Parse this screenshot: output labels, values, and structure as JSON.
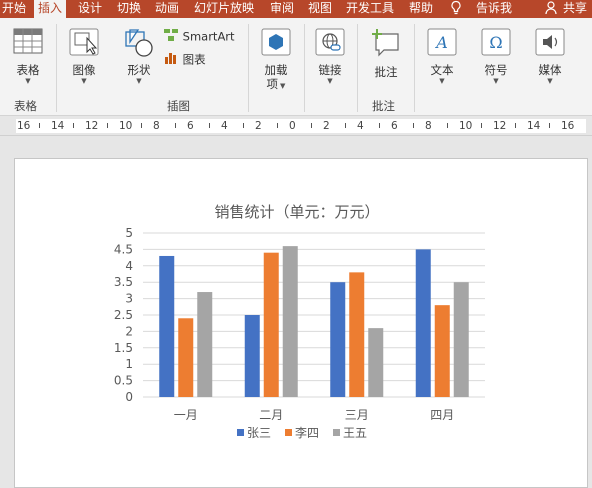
{
  "tabs": [
    {
      "label": "开始",
      "active": false
    },
    {
      "label": "插入",
      "active": true
    },
    {
      "label": "设计",
      "active": false
    },
    {
      "label": "切换",
      "active": false
    },
    {
      "label": "动画",
      "active": false
    },
    {
      "label": "幻灯片放映",
      "active": false
    },
    {
      "label": "审阅",
      "active": false
    },
    {
      "label": "视图",
      "active": false
    },
    {
      "label": "开发工具",
      "active": false
    },
    {
      "label": "帮助",
      "active": false
    }
  ],
  "tellme": {
    "label": "告诉我",
    "icon": "lightbulb-icon"
  },
  "share": {
    "label": "共享",
    "icon": "person-icon"
  },
  "ribbon": {
    "table": {
      "label": "表格",
      "group": "表格"
    },
    "image": {
      "label": "图像"
    },
    "shapes": {
      "label": "形状"
    },
    "smartart": {
      "label": "SmartArt"
    },
    "chart": {
      "label": "图表"
    },
    "illustrations_group": "插图",
    "addins": {
      "label_line1": "加载",
      "label_line2": "项"
    },
    "link": {
      "label": "链接"
    },
    "comment": {
      "label": "批注",
      "group": "批注"
    },
    "text": {
      "label": "文本"
    },
    "symbols": {
      "label": "符号"
    },
    "media": {
      "label": "媒体"
    }
  },
  "ruler": {
    "labels": [
      "16",
      "14",
      "12",
      "10",
      "8",
      "6",
      "4",
      "2",
      "0",
      "2",
      "4",
      "6",
      "8",
      "10",
      "12",
      "14",
      "16"
    ]
  },
  "colors": {
    "brand": "#b7472a",
    "series1": "#4472c4",
    "series2": "#ed7d31",
    "series3": "#a5a5a5"
  },
  "chart_data": {
    "type": "bar",
    "title": "销售统计（单元：万元）",
    "categories": [
      "一月",
      "二月",
      "三月",
      "四月"
    ],
    "series": [
      {
        "name": "张三",
        "values": [
          4.3,
          2.5,
          3.5,
          4.5
        ]
      },
      {
        "name": "李四",
        "values": [
          2.4,
          4.4,
          3.8,
          2.8
        ]
      },
      {
        "name": "王五",
        "values": [
          3.2,
          4.6,
          2.1,
          3.5
        ]
      }
    ],
    "yticks": [
      "0",
      "0.5",
      "1",
      "1.5",
      "2",
      "2.5",
      "3",
      "3.5",
      "4",
      "4.5",
      "5"
    ],
    "ylim": [
      0,
      5
    ],
    "grid": true,
    "legend": "bottom"
  }
}
